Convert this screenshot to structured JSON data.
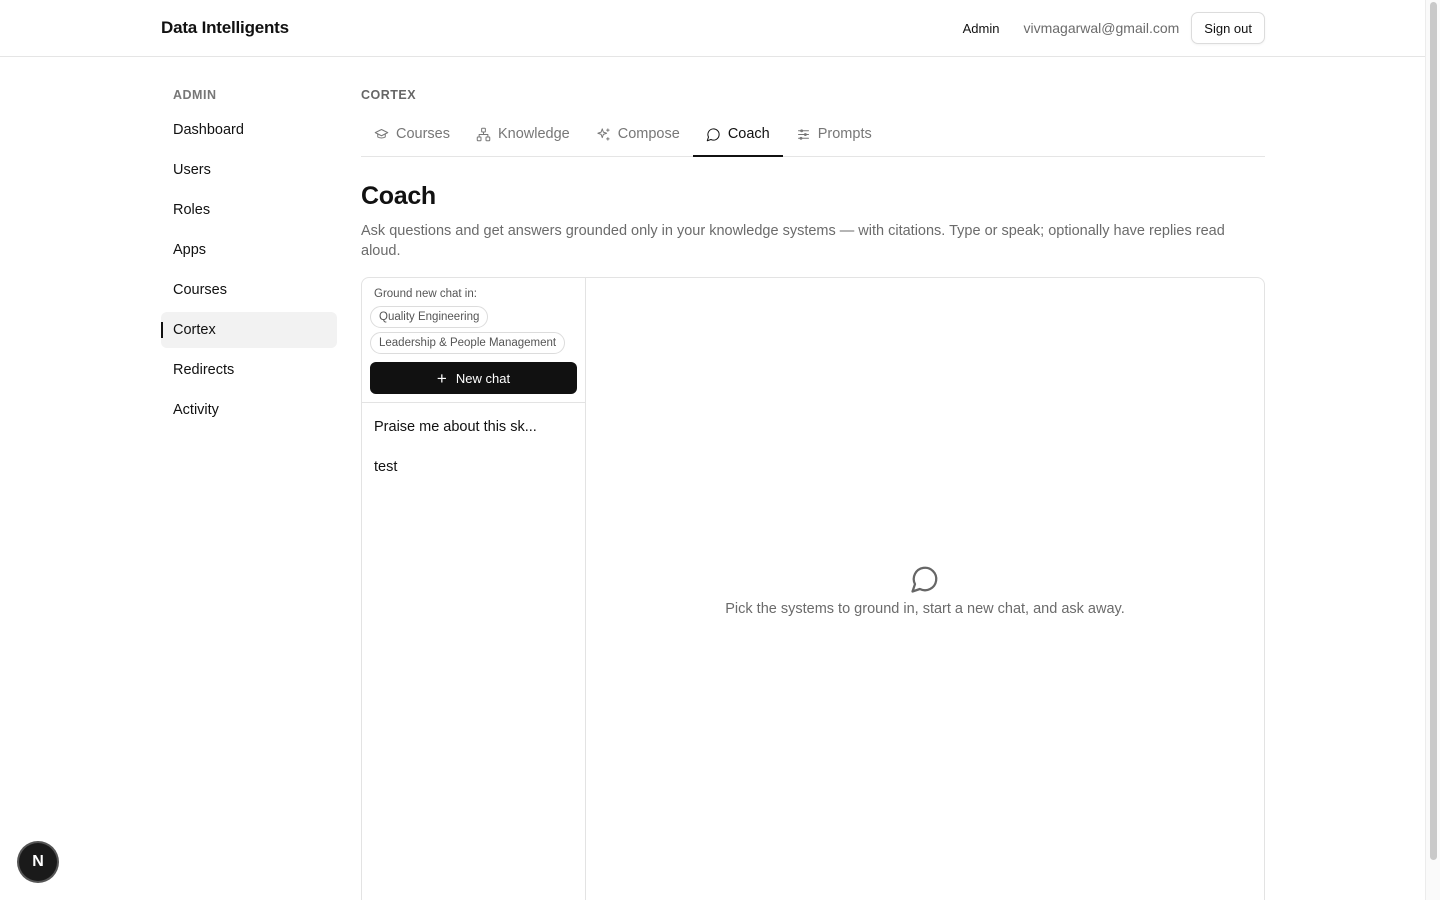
{
  "header": {
    "brand": "Data Intelligents",
    "role": "Admin",
    "email": "vivmagarwal@gmail.com",
    "signout_label": "Sign out"
  },
  "sidebar": {
    "heading": "ADMIN",
    "items": [
      {
        "label": "Dashboard"
      },
      {
        "label": "Users"
      },
      {
        "label": "Roles"
      },
      {
        "label": "Apps"
      },
      {
        "label": "Courses"
      },
      {
        "label": "Cortex",
        "active": true
      },
      {
        "label": "Redirects"
      },
      {
        "label": "Activity"
      }
    ]
  },
  "main": {
    "breadcrumb": "CORTEX",
    "tabs": [
      {
        "label": "Courses",
        "icon": "graduation-cap-icon"
      },
      {
        "label": "Knowledge",
        "icon": "network-icon"
      },
      {
        "label": "Compose",
        "icon": "sparkles-icon"
      },
      {
        "label": "Coach",
        "icon": "message-circle-icon",
        "active": true
      },
      {
        "label": "Prompts",
        "icon": "sliders-icon"
      }
    ],
    "title": "Coach",
    "description": "Ask questions and get answers grounded only in your knowledge systems — with citations. Type or speak; optionally have replies read aloud."
  },
  "coach": {
    "ground_label": "Ground new chat in:",
    "systems": [
      "Quality Engineering",
      "Leadership & People Management"
    ],
    "new_chat_label": "New chat",
    "chats": [
      "Praise me about this sk...",
      "test"
    ],
    "empty_message": "Pick the systems to ground in, start a new chat, and ask away."
  },
  "badge": {
    "letter": "N"
  },
  "colors": {
    "accent": "#111111",
    "muted_text": "#6b6b6b",
    "border": "#e3e3e3"
  }
}
